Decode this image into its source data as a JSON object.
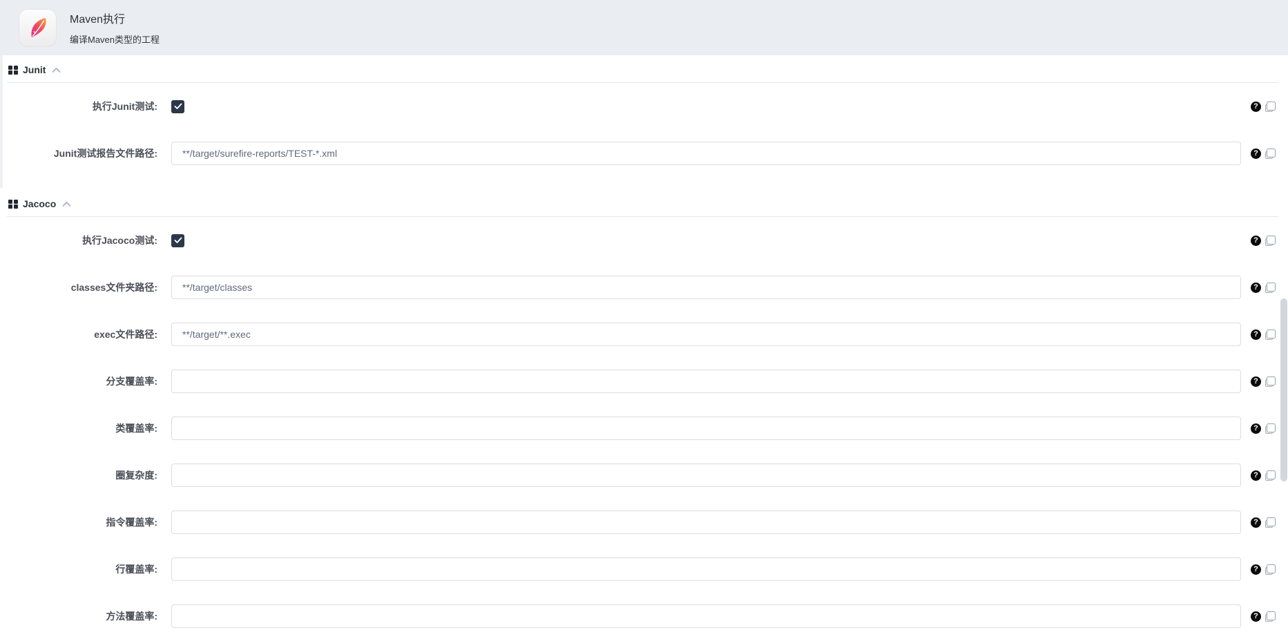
{
  "header": {
    "title": "Maven执行",
    "subtitle": "编译Maven类型的工程",
    "icon": "maven-feather-icon"
  },
  "sections": [
    {
      "id": "junit",
      "title": "Junit",
      "collapse_state": "expanded",
      "rows": [
        {
          "label": "执行Junit测试:",
          "type": "checkbox",
          "checked": true,
          "name": "run-junit-test"
        },
        {
          "label": "Junit测试报告文件路径:",
          "type": "text",
          "value": "**/target/surefire-reports/TEST-*.xml",
          "name": "junit-report-path"
        }
      ]
    },
    {
      "id": "jacoco",
      "title": "Jacoco",
      "collapse_state": "expanded",
      "rows": [
        {
          "label": "执行Jacoco测试:",
          "type": "checkbox",
          "checked": true,
          "name": "run-jacoco-test"
        },
        {
          "label": "classes文件夹路径:",
          "type": "text",
          "value": "**/target/classes",
          "name": "classes-folder-path"
        },
        {
          "label": "exec文件路径:",
          "type": "text",
          "value": "**/target/**.exec",
          "name": "exec-file-path"
        },
        {
          "label": "分支覆盖率:",
          "type": "text",
          "value": "",
          "name": "branch-coverage"
        },
        {
          "label": "类覆盖率:",
          "type": "text",
          "value": "",
          "name": "class-coverage"
        },
        {
          "label": "圈复杂度:",
          "type": "text",
          "value": "",
          "name": "cyclomatic-complexity"
        },
        {
          "label": "指令覆盖率:",
          "type": "text",
          "value": "",
          "name": "instruction-coverage"
        },
        {
          "label": "行覆盖率:",
          "type": "text",
          "value": "",
          "name": "line-coverage"
        },
        {
          "label": "方法覆盖率:",
          "type": "text",
          "value": "",
          "name": "method-coverage"
        }
      ]
    }
  ],
  "row_icon_labels": {
    "help": "?",
    "copy": "copy"
  },
  "colors": {
    "header_background": "#eaedf2",
    "checkbox_fill": "#2b3849",
    "input_border": "#d9dce2",
    "input_text": "#5f6b7a",
    "label_text": "#4b4f57",
    "divider": "#e3e7ee",
    "caret": "#9fb0c9",
    "feather_orange": "#f8a13b",
    "feather_pink": "#e42a86",
    "scrollbar_thumb": "#d3d6dc"
  }
}
